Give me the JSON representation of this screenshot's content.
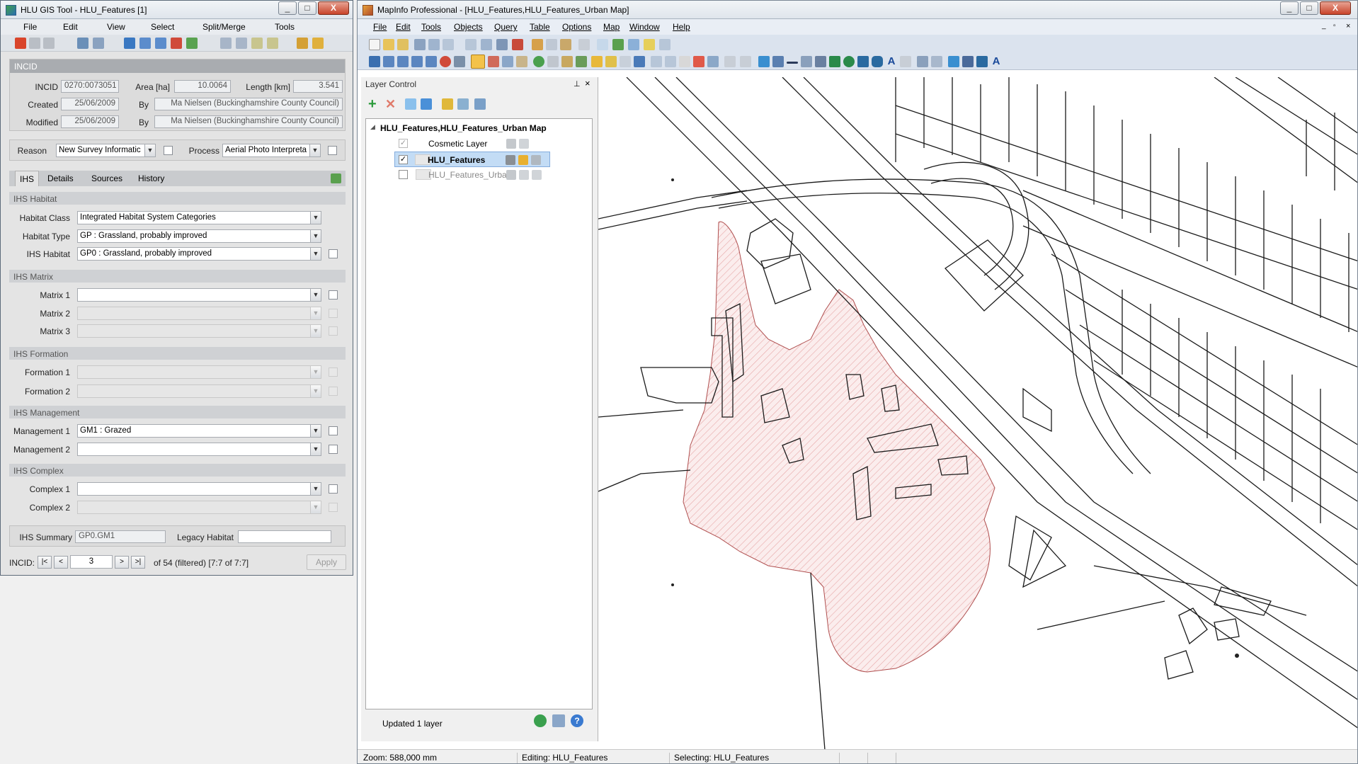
{
  "hlu": {
    "title": "HLU GIS Tool - HLU_Features [1]",
    "menu": [
      "File",
      "Edit",
      "View",
      "Select",
      "Split/Merge",
      "Tools"
    ],
    "incid_header": "INCID",
    "incid_label": "INCID",
    "incid_value": "0270:0073051",
    "area_label": "Area [ha]",
    "area_value": "10.0064",
    "length_label": "Length [km]",
    "length_value": "3.541",
    "created_label": "Created",
    "created_date": "25/06/2009",
    "by_label": "By",
    "created_by": "Ma Nielsen (Buckinghamshire County Council)",
    "modified_label": "Modified",
    "modified_date": "25/06/2009",
    "modified_by": "Ma Nielsen (Buckinghamshire County Council)",
    "reason_label": "Reason",
    "reason_value": "New Survey Informatic",
    "process_label": "Process",
    "process_value": "Aerial Photo Interpreta",
    "tabs": [
      "IHS",
      "Details",
      "Sources",
      "History"
    ],
    "ihs_habitat_group": "IHS Habitat",
    "habitat_class_label": "Habitat Class",
    "habitat_class_value": "Integrated Habitat System Categories",
    "habitat_type_label": "Habitat Type",
    "habitat_type_value": "GP : Grassland, probably improved",
    "ihs_habitat_label": "IHS Habitat",
    "ihs_habitat_value": "GP0 : Grassland, probably improved",
    "ihs_matrix_group": "IHS Matrix",
    "matrix_labels": [
      "Matrix 1",
      "Matrix 2",
      "Matrix 3"
    ],
    "ihs_formation_group": "IHS Formation",
    "formation_labels": [
      "Formation 1",
      "Formation 2"
    ],
    "ihs_management_group": "IHS Management",
    "management1_label": "Management 1",
    "management1_value": "GM1 : Grazed",
    "management2_label": "Management 2",
    "ihs_complex_group": "IHS Complex",
    "complex_labels": [
      "Complex 1",
      "Complex 2"
    ],
    "summary_label": "IHS Summary",
    "summary_value": "GP0.GM1",
    "legacy_label": "Legacy Habitat",
    "nav_label": "INCID:",
    "nav_first": "|<",
    "nav_prev": "<",
    "nav_value": "3",
    "nav_next": ">",
    "nav_last": ">|",
    "nav_status": "of 54 (filtered) [7:7 of 7:7]",
    "apply_label": "Apply"
  },
  "mapinfo": {
    "title": "MapInfo Professional - [HLU_Features,HLU_Features_Urban Map]",
    "menu": [
      "File",
      "Edit",
      "Tools",
      "Objects",
      "Query",
      "Table",
      "Options",
      "Map",
      "Window",
      "Help"
    ],
    "layer_control_title": "Layer Control",
    "map_node": "HLU_Features,HLU_Features_Urban Map",
    "layers": [
      {
        "name": "Cosmetic Layer",
        "checked": true
      },
      {
        "name": "HLU_Features",
        "checked": true
      },
      {
        "name": "HLU_Features_Urba",
        "checked": false
      }
    ],
    "layer_status": "Updated 1 layer",
    "status_zoom": "Zoom: 588,000 mm",
    "status_editing": "Editing: HLU_Features",
    "status_selecting": "Selecting: HLU_Features",
    "accent": "#316ac5"
  }
}
